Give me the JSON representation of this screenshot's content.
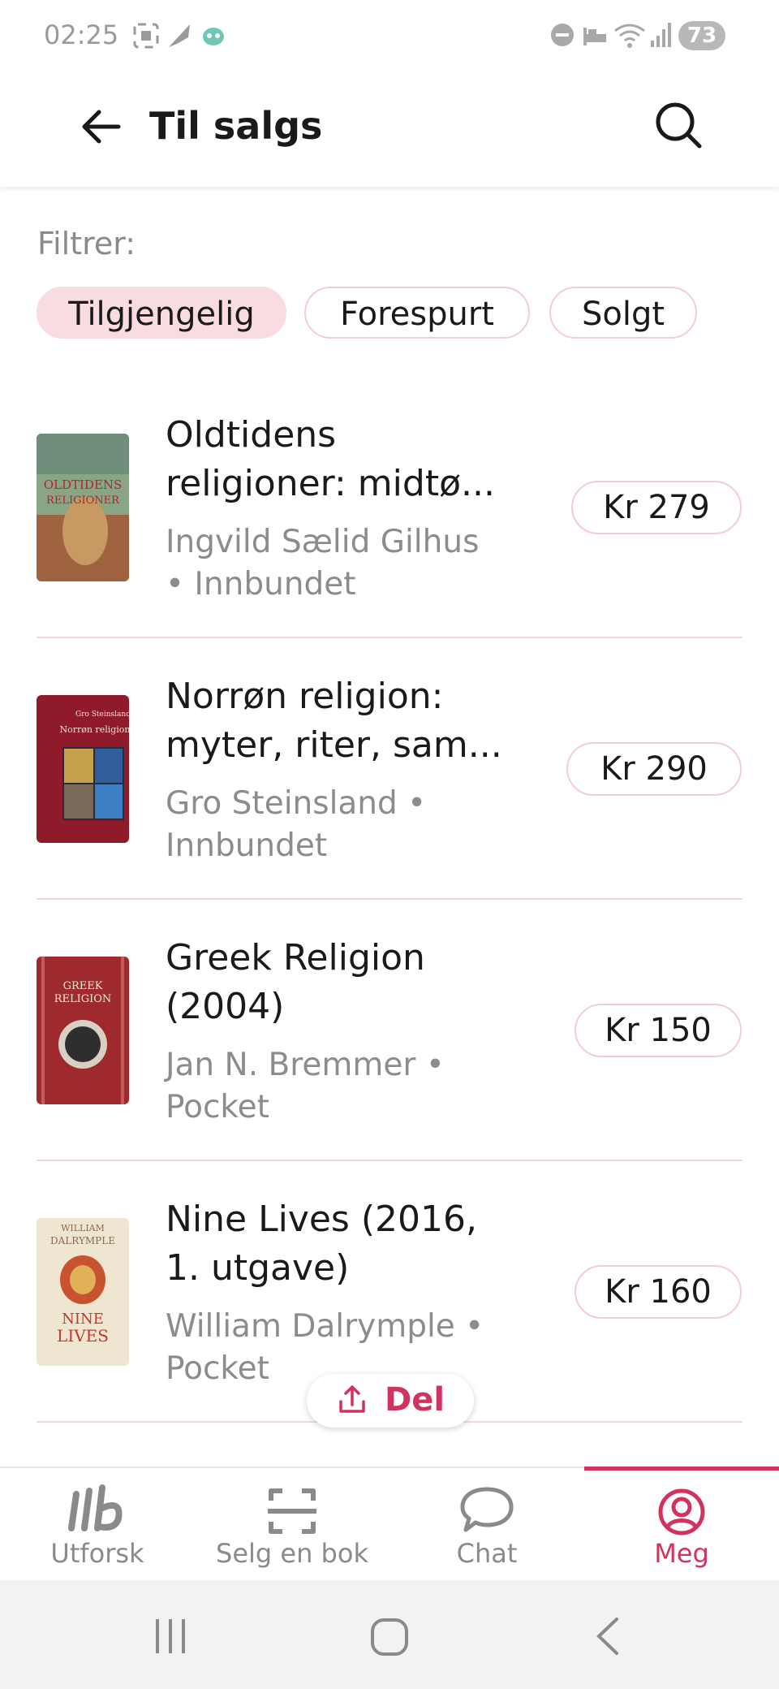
{
  "status_bar": {
    "time": "02:25",
    "battery": "73"
  },
  "header": {
    "title": "Til salgs"
  },
  "filter": {
    "label": "Filtrer:",
    "chips": [
      {
        "label": "Tilgjengelig",
        "active": true
      },
      {
        "label": "Forespurt",
        "active": false
      },
      {
        "label": "Solgt",
        "active": false
      }
    ]
  },
  "listings": [
    {
      "title_line1": "Oldtidens",
      "title_line2": "religioner: midtø...",
      "meta_line1": "Ingvild Sælid Gilhus",
      "meta_line2": "• Innbundet",
      "price": "Kr 279",
      "cover_text": "OLDTIDENS RELIGIONER"
    },
    {
      "title_line1": "Norrøn religion:",
      "title_line2": "myter, riter, sam...",
      "meta_line1": "Gro Steinsland •",
      "meta_line2": "Innbundet",
      "price": "Kr 290",
      "cover_text": "Norrøn religion"
    },
    {
      "title_line1": "Greek Religion",
      "title_line2": "(2004)",
      "meta_line1": "Jan N. Bremmer •",
      "meta_line2": "Pocket",
      "price": "Kr 150",
      "cover_text": "GREEK RELIGION"
    },
    {
      "title_line1": "Nine Lives (2016,",
      "title_line2": "1. utgave)",
      "meta_line1": "William Dalrymple •",
      "meta_line2": "Pocket",
      "price": "Kr 160",
      "cover_text": "NINE LIVES"
    }
  ],
  "share_button": {
    "label": "Del"
  },
  "bottom_nav": [
    {
      "label": "Utforsk",
      "icon": "explore-icon",
      "active": false
    },
    {
      "label": "Selg en bok",
      "icon": "scan-icon",
      "active": false
    },
    {
      "label": "Chat",
      "icon": "chat-icon",
      "active": false
    },
    {
      "label": "Meg",
      "icon": "profile-icon",
      "active": true
    }
  ],
  "colors": {
    "accent": "#d0345e",
    "chip_active_bg": "#f9dbe2",
    "chip_border": "#f3cdd5"
  }
}
